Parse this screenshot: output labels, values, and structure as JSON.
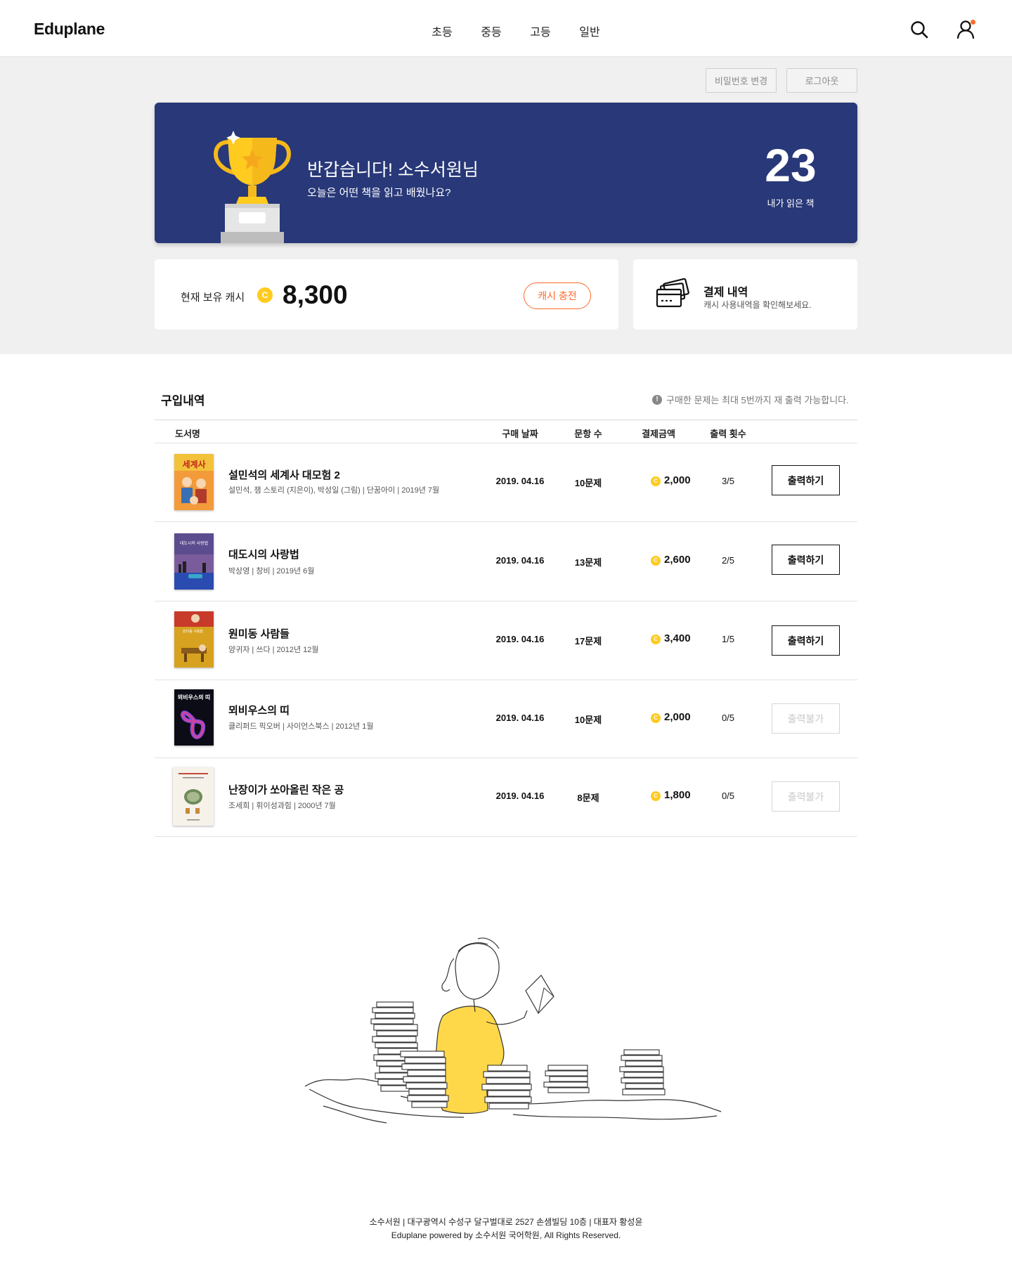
{
  "header": {
    "logo": "Eduplane",
    "nav": [
      "초등",
      "중등",
      "고등",
      "일반"
    ]
  },
  "account": {
    "change_password_label": "비밀번호 변경",
    "logout_label": "로그아웃"
  },
  "hero": {
    "greeting": "반갑습니다! 소수서원님",
    "subtitle": "오늘은 어떤 책을 읽고 배웠나요?",
    "books_read": "23",
    "books_read_label": "내가 읽은 책"
  },
  "cash": {
    "label": "현재 보유 캐시",
    "coin_symbol": "C",
    "amount": "8,300",
    "charge_label": "캐시 충전"
  },
  "payment": {
    "title": "결제 내역",
    "subtitle": "캐시 사용내역을 확인해보세요."
  },
  "purchases": {
    "title": "구입내역",
    "notice": "구매한 문제는 최대 5번까지 재 출력 가능합니다.",
    "columns": {
      "book": "도서명",
      "date": "구매 날짜",
      "questions": "문항 수",
      "price": "결제금액",
      "prints": "출력 횟수"
    },
    "rows": [
      {
        "title": "설민석의 세계사 대모험 2",
        "meta": "설민석, 잼 스토리 (지은이), 박성일 (그림) | 단꿈아이 | 2019년 7월",
        "date": "2019. 04.16",
        "questions": "10문제",
        "price": "2,000",
        "prints": "3/5",
        "action": "출력하기"
      },
      {
        "title": "대도시의 사랑법",
        "meta": "박상영 | 창비 | 2019년 6월",
        "date": "2019. 04.16",
        "questions": "13문제",
        "price": "2,600",
        "prints": "2/5",
        "action": "출력하기"
      },
      {
        "title": "원미동 사람들",
        "meta": "양귀자 | 쓰다 | 2012년 12월",
        "date": "2019. 04.16",
        "questions": "17문제",
        "price": "3,400",
        "prints": "1/5",
        "action": "출력하기"
      },
      {
        "title": "뫼비우스의 띠",
        "meta": "클리퍼드 픽오버 | 사이언스북스 | 2012년 1월",
        "date": "2019. 04.16",
        "questions": "10문제",
        "price": "2,000",
        "prints": "0/5",
        "action": "출력불가"
      },
      {
        "title": "난장이가 쏘아올린 작은 공",
        "meta": "조세희 | 휘이성과힘 | 2000년 7월",
        "date": "2019. 04.16",
        "questions": "8문제",
        "price": "1,800",
        "prints": "0/5",
        "action": "출력불가"
      }
    ]
  },
  "covers": [
    {
      "text": "세계사"
    },
    {
      "text": "대도시의 사랑법"
    },
    {
      "text": "원미동 사람들"
    },
    {
      "text": "뫼비우스의 띠"
    },
    {
      "text": ""
    }
  ],
  "footer": {
    "line1": "소수서원 | 대구광역시 수성구 달구벌대로 2527 손샘빌딩 10층 | 대표자 황성윤",
    "line2": "Eduplane powered by 소수서원 국어학원, All Rights Reserved."
  },
  "colors": {
    "hero_bg": "#283878",
    "accent": "#ff6a2b",
    "coin": "#ffcb1f"
  }
}
